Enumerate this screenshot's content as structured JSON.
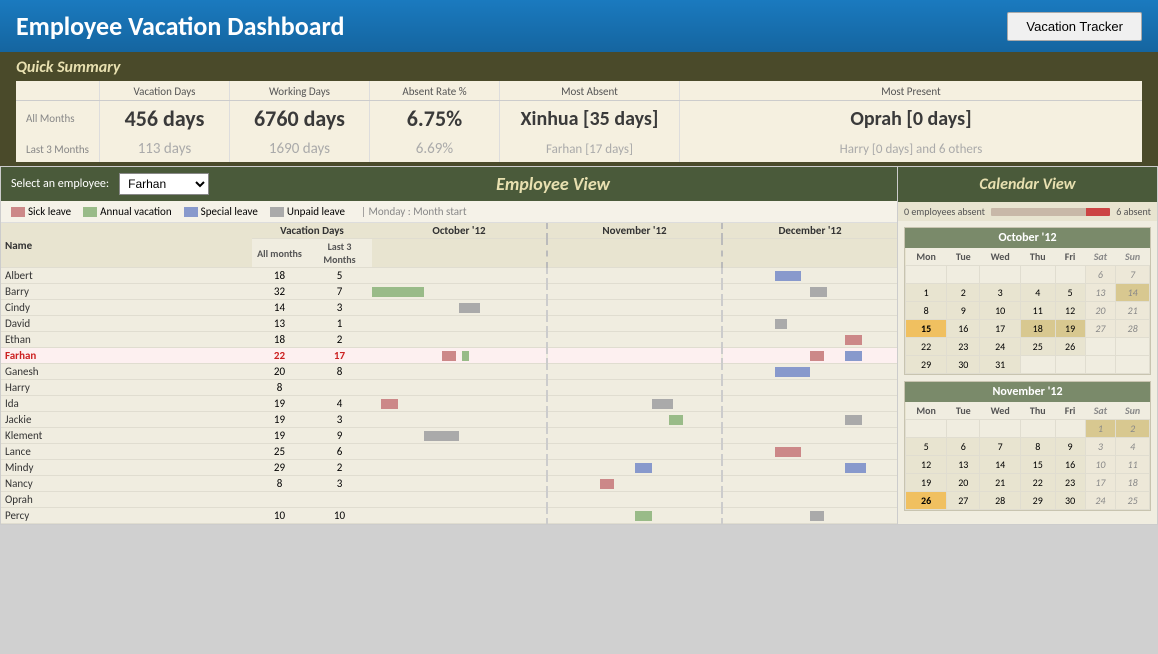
{
  "header": {
    "title": "Employee Vacation Dashboard",
    "button_label": "Vacation Tracker"
  },
  "quick_summary": {
    "section_title": "Quick Summary",
    "columns": [
      "Vacation Days",
      "Working Days",
      "Absent Rate %",
      "Most Absent",
      "Most Present"
    ],
    "rows": [
      {
        "label": "All Months",
        "vacation_days": "456 days",
        "working_days": "6760 days",
        "absent_rate": "6.75%",
        "most_absent": "Xinhua [35 days]",
        "most_present": "Oprah [0 days]"
      },
      {
        "label": "Last 3 Months",
        "vacation_days": "113 days",
        "working_days": "1690 days",
        "absent_rate": "6.69%",
        "most_absent": "Farhan [17 days]",
        "most_present": "Harry [0 days] and 6 others"
      }
    ]
  },
  "employee_view": {
    "select_label": "Select an employee:",
    "selected_employee": "Farhan",
    "title": "Employee View",
    "legend": [
      {
        "label": "Sick leave",
        "color": "#cc8888"
      },
      {
        "label": "Annual vacation",
        "color": "#99bb88"
      },
      {
        "label": "Special leave",
        "color": "#8899cc"
      },
      {
        "label": "Unpaid leave",
        "color": "#aaaaaa"
      },
      {
        "label": "| Monday : Month start",
        "color": null
      }
    ],
    "table_headers": {
      "vacation_days": "Vacation Days",
      "all_months": "All months",
      "last_3_months": "Last 3 Months",
      "name": "Name"
    },
    "month_headers": [
      "October '12",
      "November '12",
      "December '12"
    ],
    "employees": [
      {
        "name": "Albert",
        "all_months": 18,
        "last_3": 5,
        "highlighted": false
      },
      {
        "name": "Barry",
        "all_months": 32,
        "last_3": 7,
        "highlighted": false
      },
      {
        "name": "Cindy",
        "all_months": 14,
        "last_3": 3,
        "highlighted": false
      },
      {
        "name": "David",
        "all_months": 13,
        "last_3": 1,
        "highlighted": false
      },
      {
        "name": "Ethan",
        "all_months": 18,
        "last_3": 2,
        "highlighted": false
      },
      {
        "name": "Farhan",
        "all_months": 22,
        "last_3": 17,
        "highlighted": true
      },
      {
        "name": "Ganesh",
        "all_months": 20,
        "last_3": 8,
        "highlighted": false
      },
      {
        "name": "Harry",
        "all_months": 8,
        "last_3": null,
        "highlighted": false
      },
      {
        "name": "Ida",
        "all_months": 19,
        "last_3": 4,
        "highlighted": false
      },
      {
        "name": "Jackie",
        "all_months": 19,
        "last_3": 3,
        "highlighted": false
      },
      {
        "name": "Klement",
        "all_months": 19,
        "last_3": 9,
        "highlighted": false
      },
      {
        "name": "Lance",
        "all_months": 25,
        "last_3": 6,
        "highlighted": false
      },
      {
        "name": "Mindy",
        "all_months": 29,
        "last_3": 2,
        "highlighted": false
      },
      {
        "name": "Nancy",
        "all_months": 8,
        "last_3": 3,
        "highlighted": false
      },
      {
        "name": "Oprah",
        "all_months": null,
        "last_3": null,
        "highlighted": false
      },
      {
        "name": "Percy",
        "all_months": 10,
        "last_3": 10,
        "highlighted": false
      }
    ]
  },
  "calendar_view": {
    "title": "Calendar View",
    "absence_bar": {
      "min_label": "0 employees absent",
      "max_label": "6 absent"
    },
    "months": [
      {
        "name": "October '12",
        "headers": [
          "Mon",
          "Tue",
          "Wed",
          "Thu",
          "Fri",
          "Sat",
          "Sun"
        ],
        "weeks": [
          [
            null,
            null,
            null,
            null,
            null,
            "6",
            "7"
          ],
          [
            "1",
            "2",
            "3",
            "4",
            "5",
            "13",
            "14"
          ],
          [
            "8",
            "9",
            "10",
            "11",
            "12",
            "20",
            "21"
          ],
          [
            "15",
            "16",
            "17",
            "18",
            "19",
            "27",
            "28"
          ],
          [
            "22",
            "23",
            "24",
            "25",
            "26",
            null,
            null
          ],
          [
            "29",
            "30",
            "31",
            null,
            null,
            null,
            null
          ]
        ],
        "days": [
          {
            "d": 1,
            "type": "normal"
          },
          {
            "d": 2,
            "type": "normal"
          },
          {
            "d": 3,
            "type": "normal"
          },
          {
            "d": 4,
            "type": "normal"
          },
          {
            "d": 5,
            "type": "normal"
          },
          {
            "d": 6,
            "type": "weekend"
          },
          {
            "d": 7,
            "type": "weekend"
          },
          {
            "d": 8,
            "type": "normal"
          },
          {
            "d": 9,
            "type": "normal"
          },
          {
            "d": 10,
            "type": "normal"
          },
          {
            "d": 11,
            "type": "normal"
          },
          {
            "d": 12,
            "type": "normal"
          },
          {
            "d": 13,
            "type": "weekend"
          },
          {
            "d": 14,
            "type": "weekend-highlight"
          },
          {
            "d": 15,
            "type": "today"
          },
          {
            "d": 16,
            "type": "normal"
          },
          {
            "d": 17,
            "type": "normal"
          },
          {
            "d": 18,
            "type": "highlighted"
          },
          {
            "d": 19,
            "type": "highlighted"
          },
          {
            "d": 20,
            "type": "weekend-italic"
          },
          {
            "d": 21,
            "type": "weekend-italic"
          },
          {
            "d": 22,
            "type": "normal"
          },
          {
            "d": 23,
            "type": "normal"
          },
          {
            "d": 24,
            "type": "normal"
          },
          {
            "d": 25,
            "type": "normal"
          },
          {
            "d": 26,
            "type": "normal"
          },
          {
            "d": 27,
            "type": "weekend-italic"
          },
          {
            "d": 28,
            "type": "weekend-italic"
          },
          {
            "d": 29,
            "type": "normal"
          },
          {
            "d": 30,
            "type": "normal"
          },
          {
            "d": 31,
            "type": "normal"
          }
        ]
      },
      {
        "name": "November '12",
        "headers": [
          "Mon",
          "Tue",
          "Wed",
          "Thu",
          "Fri",
          "Sat",
          "Sun"
        ],
        "days": [
          {
            "d": 1,
            "type": "highlighted"
          },
          {
            "d": 2,
            "type": "highlighted"
          },
          {
            "d": 3,
            "type": "weekend-italic"
          },
          {
            "d": 4,
            "type": "weekend-italic"
          },
          {
            "d": 5,
            "type": "normal"
          },
          {
            "d": 6,
            "type": "normal"
          },
          {
            "d": 7,
            "type": "normal"
          },
          {
            "d": 8,
            "type": "normal"
          },
          {
            "d": 9,
            "type": "normal"
          },
          {
            "d": 10,
            "type": "weekend-italic"
          },
          {
            "d": 11,
            "type": "weekend-italic"
          },
          {
            "d": 12,
            "type": "normal"
          },
          {
            "d": 13,
            "type": "normal"
          },
          {
            "d": 14,
            "type": "normal"
          },
          {
            "d": 15,
            "type": "normal"
          },
          {
            "d": 16,
            "type": "normal"
          },
          {
            "d": 17,
            "type": "weekend-italic"
          },
          {
            "d": 18,
            "type": "weekend-italic"
          },
          {
            "d": 19,
            "type": "normal"
          },
          {
            "d": 20,
            "type": "normal"
          },
          {
            "d": 21,
            "type": "normal"
          },
          {
            "d": 22,
            "type": "normal"
          },
          {
            "d": 23,
            "type": "normal"
          },
          {
            "d": 24,
            "type": "weekend-italic"
          },
          {
            "d": 25,
            "type": "weekend-italic"
          },
          {
            "d": 26,
            "type": "today"
          },
          {
            "d": 27,
            "type": "normal"
          },
          {
            "d": 28,
            "type": "normal"
          },
          {
            "d": 29,
            "type": "normal"
          },
          {
            "d": 30,
            "type": "normal"
          }
        ]
      }
    ]
  },
  "colors": {
    "sick_leave": "#cc8888",
    "annual_vacation": "#99bb88",
    "special_leave": "#8899cc",
    "unpaid_leave": "#aaaaaa",
    "header_bg": "#1a7abf",
    "section_header": "#4a5a3a",
    "month_header": "#7a8a6a",
    "summary_bg": "#4a4a2a"
  }
}
